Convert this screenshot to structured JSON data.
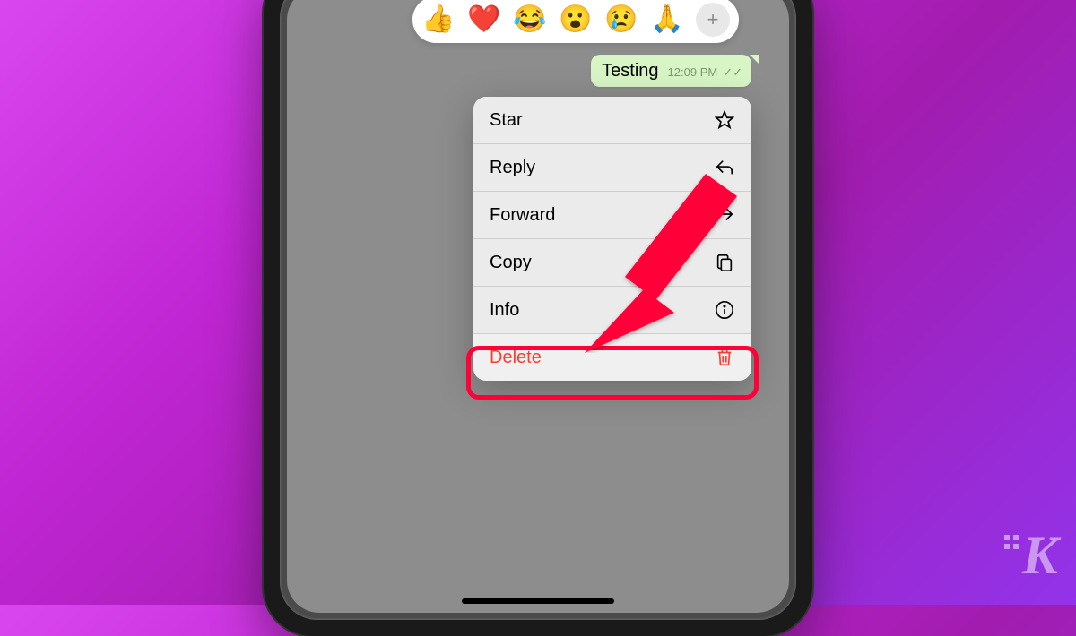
{
  "reactions": {
    "emojis": [
      "👍",
      "❤️",
      "😂",
      "😮",
      "😢",
      "🙏"
    ],
    "plus_label": "+"
  },
  "message": {
    "text": "Testing",
    "time": "12:09 PM",
    "ticks": "✓✓"
  },
  "menu": {
    "star": "Star",
    "reply": "Reply",
    "forward": "Forward",
    "copy": "Copy",
    "info": "Info",
    "delete": "Delete"
  },
  "icons": {
    "star": "star-icon",
    "reply": "reply-icon",
    "forward": "forward-icon",
    "copy": "copy-icon",
    "info": "info-icon",
    "delete": "trash-icon"
  },
  "colors": {
    "danger": "#ff3b30",
    "highlight": "#ff0037"
  },
  "watermark": "K"
}
